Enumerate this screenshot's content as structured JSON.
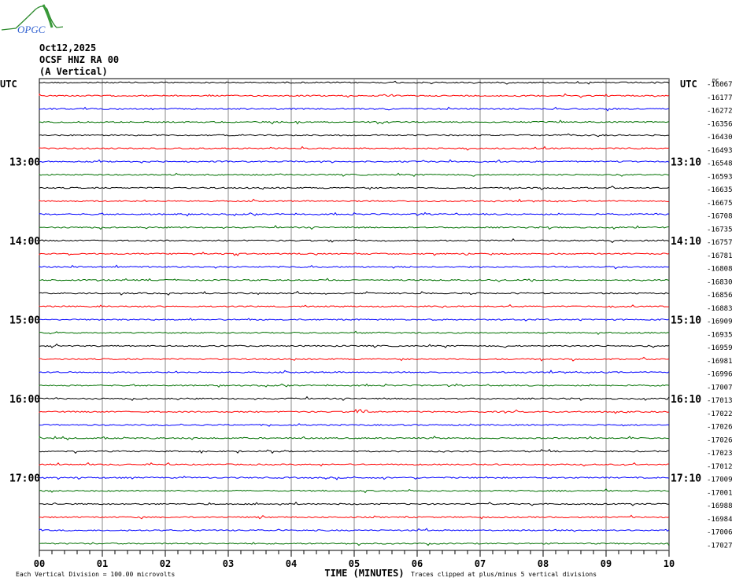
{
  "logo": {
    "text": "OPGC"
  },
  "header": {
    "date": "Oct12,2025",
    "station": "OCSF HNZ RA 00",
    "component": "(A Vertical)"
  },
  "chart_data": {
    "type": "line",
    "title": "Oct12,2025 OCSF HNZ RA 00 (A Vertical)",
    "xlabel": "TIME (MINUTES)",
    "xlim": [
      0,
      10
    ],
    "x_ticks": [
      "00",
      "01",
      "02",
      "03",
      "04",
      "05",
      "06",
      "07",
      "08",
      "09",
      "10"
    ],
    "left_axis_title": "UTC",
    "right_axis_title": "UTC",
    "dc_header": "DC",
    "left_hour_labels": [
      {
        "row": 6,
        "label": "13:00"
      },
      {
        "row": 12,
        "label": "14:00"
      },
      {
        "row": 18,
        "label": "15:00"
      },
      {
        "row": 24,
        "label": "16:00"
      },
      {
        "row": 30,
        "label": "17:00"
      }
    ],
    "right_hour_labels": [
      {
        "row": 6,
        "label": "13:10"
      },
      {
        "row": 12,
        "label": "14:10"
      },
      {
        "row": 18,
        "label": "15:10"
      },
      {
        "row": 24,
        "label": "16:10"
      },
      {
        "row": 30,
        "label": "17:10"
      }
    ],
    "trace_colors": [
      "#000000",
      "#ff0000",
      "#0000ff",
      "#007000"
    ],
    "dc_offsets": [
      "-16067",
      "-16177",
      "-16272",
      "-16356",
      "-16430",
      "-16493",
      "-16548",
      "-16593",
      "-16635",
      "-16675",
      "-16708",
      "-16735",
      "-16757",
      "-16781",
      "-16808",
      "-16830",
      "-16856",
      "-16883",
      "-16909",
      "-16935",
      "-16959",
      "-16981",
      "-16996",
      "-17007",
      "-17013",
      "-17022",
      "-17026",
      "-17026",
      "-17023",
      "-17012",
      "-17009",
      "-17001",
      "-16988",
      "-16984",
      "-17006",
      "-17027"
    ],
    "scale_note": "Each Vertical Division =  100.00 microvolts",
    "clip_note": "Traces clipped at plus/minus 5 vertical divisions"
  }
}
